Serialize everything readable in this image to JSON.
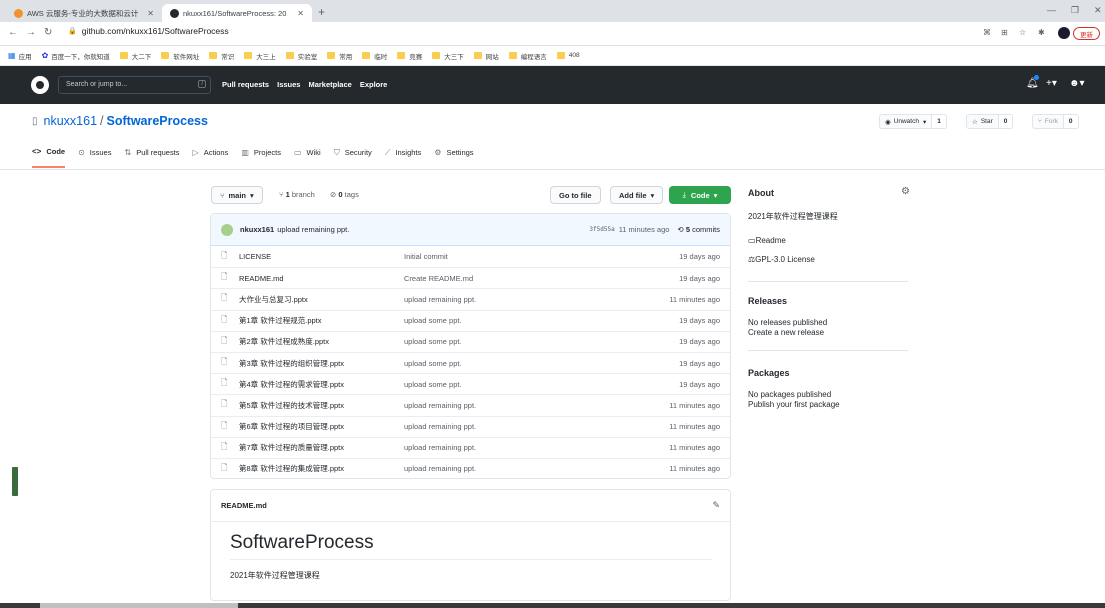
{
  "browser": {
    "tabs": [
      {
        "title": "AWS 云服务-专业的大数据和云计",
        "favicon_color": "#f0932b"
      },
      {
        "title": "nkuxx161/SoftwareProcess: 20",
        "favicon_color": "#24292e"
      }
    ],
    "new_tab": "+",
    "url": "github.com/nkuxx161/SoftwareProcess",
    "update_label": "更新",
    "bookmarks": [
      "应用",
      "百度一下，你就知道",
      "大二下",
      "软件网址",
      "常识",
      "大三上",
      "实验室",
      "常用",
      "临时",
      "竞赛",
      "大三下",
      "网站",
      "编程语言",
      "408"
    ]
  },
  "gh": {
    "search_placeholder": "Search or jump to...",
    "search_key": "/",
    "nav": [
      "Pull requests",
      "Issues",
      "Marketplace",
      "Explore"
    ]
  },
  "repo": {
    "owner": "nkuxx161",
    "separator": "/",
    "name": "SoftwareProcess",
    "watch_label": "Unwatch",
    "watch_count": "1",
    "star_label": "Star",
    "star_count": "0",
    "fork_label": "Fork",
    "fork_count": "0",
    "tabs": [
      "Code",
      "Issues",
      "Pull requests",
      "Actions",
      "Projects",
      "Wiki",
      "Security",
      "Insights",
      "Settings"
    ]
  },
  "filenav": {
    "branch": "main",
    "branch_count": "1",
    "branch_word": "branch",
    "tag_count": "0",
    "tag_word": "tags",
    "go_to_file": "Go to file",
    "add_file": "Add file",
    "code": "Code"
  },
  "commit": {
    "author": "nkuxx161",
    "message": "upload remaining ppt.",
    "sha": "3f5d55a",
    "age": "11 minutes ago",
    "count": "5",
    "count_word": "commits"
  },
  "files": [
    {
      "name": "LICENSE",
      "message": "Initial commit",
      "age": "19 days ago"
    },
    {
      "name": "README.md",
      "message": "Create README.md",
      "age": "19 days ago"
    },
    {
      "name": "大作业与总复习.pptx",
      "message": "upload remaining ppt.",
      "age": "11 minutes ago"
    },
    {
      "name": "第1章 软件过程规范.pptx",
      "message": "upload some ppt.",
      "age": "19 days ago"
    },
    {
      "name": "第2章 软件过程成熟度.pptx",
      "message": "upload some ppt.",
      "age": "19 days ago"
    },
    {
      "name": "第3章 软件过程的组织管理.pptx",
      "message": "upload some ppt.",
      "age": "19 days ago"
    },
    {
      "name": "第4章 软件过程的需求管理.pptx",
      "message": "upload some ppt.",
      "age": "19 days ago"
    },
    {
      "name": "第5章 软件过程的技术管理.pptx",
      "message": "upload remaining ppt.",
      "age": "11 minutes ago"
    },
    {
      "name": "第6章 软件过程的项目管理.pptx",
      "message": "upload remaining ppt.",
      "age": "11 minutes ago"
    },
    {
      "name": "第7章 软件过程的质量管理.pptx",
      "message": "upload remaining ppt.",
      "age": "11 minutes ago"
    },
    {
      "name": "第8章 软件过程的集成管理.pptx",
      "message": "upload remaining ppt.",
      "age": "11 minutes ago"
    }
  ],
  "readme": {
    "filename": "README.md",
    "heading": "SoftwareProcess",
    "body": "2021年软件过程管理课程"
  },
  "about": {
    "title": "About",
    "description": "2021年软件过程管理课程",
    "readme_link": "Readme",
    "license": "GPL-3.0 License"
  },
  "releases": {
    "title": "Releases",
    "empty": "No releases published",
    "create": "Create a new release"
  },
  "packages": {
    "title": "Packages",
    "empty": "No packages published",
    "publish": "Publish your first package"
  },
  "colors": {
    "header_bg": "#24292e",
    "link": "#0366d6",
    "code_button": "#2ea44f",
    "active_tab_underline": "#f9826c"
  }
}
